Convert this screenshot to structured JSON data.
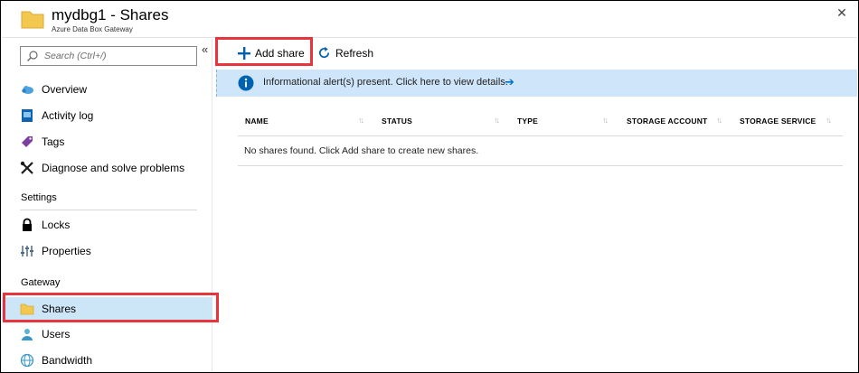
{
  "header": {
    "title": "mydbg1  -  Shares",
    "subtitle": "Azure Data Box Gateway",
    "close_glyph": "✕",
    "folder_icon": "folder-icon",
    "folder_color": "#f3c84f"
  },
  "sidebar": {
    "search_placeholder": "Search (Ctrl+/)",
    "collapse_glyph": "«",
    "items": [
      {
        "label": "Overview",
        "icon": "cloud-icon"
      },
      {
        "label": "Activity log",
        "icon": "activity-log-icon"
      },
      {
        "label": "Tags",
        "icon": "tag-icon"
      },
      {
        "label": "Diagnose and solve problems",
        "icon": "wrench-icon"
      }
    ],
    "sections": [
      {
        "label": "Settings",
        "items": [
          {
            "label": "Locks",
            "icon": "lock-icon"
          },
          {
            "label": "Properties",
            "icon": "properties-icon"
          }
        ]
      },
      {
        "label": "Gateway",
        "items": [
          {
            "label": "Shares",
            "icon": "folder-icon",
            "active": true
          },
          {
            "label": "Users",
            "icon": "user-icon"
          },
          {
            "label": "Bandwidth",
            "icon": "bandwidth-icon"
          }
        ]
      }
    ]
  },
  "toolbar": {
    "add_share_label": "Add share",
    "refresh_label": "Refresh"
  },
  "alert": {
    "text": "Informational alert(s) present. Click here to view details.",
    "arrow_glyph": "➔"
  },
  "table": {
    "columns": [
      "NAME",
      "STATUS",
      "TYPE",
      "STORAGE ACCOUNT",
      "STORAGE SERVICE"
    ],
    "sort_glyph": "↑↓",
    "empty_message": "No shares found. Click Add share to create new shares."
  },
  "colors": {
    "accent": "#0072c6",
    "highlight": "#e8343d",
    "active_item_bg": "#cde6f7",
    "alert_bg": "#cfe5f9"
  }
}
